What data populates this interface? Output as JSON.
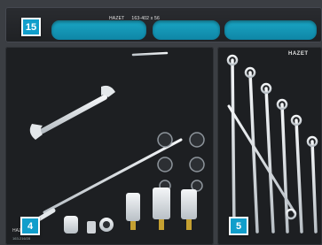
{
  "tray_header": {
    "brand": "HAZET",
    "model": "163-402 x 56"
  },
  "badges": {
    "top": "15",
    "left": "4",
    "right": "5"
  },
  "left_tray": {
    "brand": "HAZET",
    "code": "163-216/28"
  },
  "right_tray": {
    "brand": "HAZET"
  },
  "colors": {
    "accent": "#119ecb",
    "foam": "#1d1f22",
    "tool": "#d7dbdf"
  }
}
